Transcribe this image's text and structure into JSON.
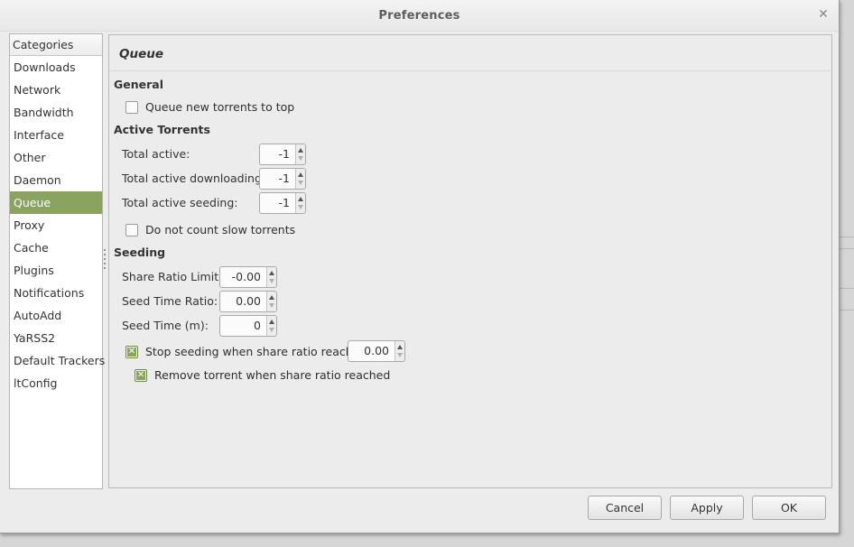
{
  "window": {
    "title": "Preferences"
  },
  "sidebar": {
    "header": "Categories",
    "items": [
      {
        "label": "Downloads"
      },
      {
        "label": "Network"
      },
      {
        "label": "Bandwidth"
      },
      {
        "label": "Interface"
      },
      {
        "label": "Other"
      },
      {
        "label": "Daemon"
      },
      {
        "label": "Queue",
        "selected": true
      },
      {
        "label": "Proxy"
      },
      {
        "label": "Cache"
      },
      {
        "label": "Plugins"
      },
      {
        "label": "Notifications"
      },
      {
        "label": "AutoAdd"
      },
      {
        "label": "YaRSS2"
      },
      {
        "label": "Default Trackers"
      },
      {
        "label": "ltConfig"
      }
    ]
  },
  "page": {
    "heading": "Queue",
    "general": {
      "title": "General",
      "queue_new_to_top": {
        "label": "Queue new torrents to top",
        "checked": false
      }
    },
    "active": {
      "title": "Active Torrents",
      "total_active": {
        "label": "Total active:",
        "value": "-1"
      },
      "total_downloading": {
        "label": "Total active downloading:",
        "value": "-1"
      },
      "total_seeding": {
        "label": "Total active seeding:",
        "value": "-1"
      },
      "dont_count_slow": {
        "label": "Do not count slow torrents",
        "checked": false
      }
    },
    "seeding": {
      "title": "Seeding",
      "share_ratio_limit": {
        "label": "Share Ratio Limit:",
        "value": "-0.00"
      },
      "seed_time_ratio": {
        "label": "Seed Time Ratio:",
        "value": "0.00"
      },
      "seed_time": {
        "label": "Seed Time (m):",
        "value": "0"
      },
      "stop_seeding": {
        "label": "Stop seeding when share ratio reaches:",
        "checked": true,
        "value": "0.00"
      },
      "remove_torrent": {
        "label": "Remove torrent when share ratio reached",
        "checked": true
      }
    }
  },
  "buttons": {
    "cancel": "Cancel",
    "apply": "Apply",
    "ok": "OK"
  },
  "colors": {
    "accent": "#8aa35f",
    "window_bg": "#ececec"
  },
  "icons": {
    "close": "close-icon"
  }
}
